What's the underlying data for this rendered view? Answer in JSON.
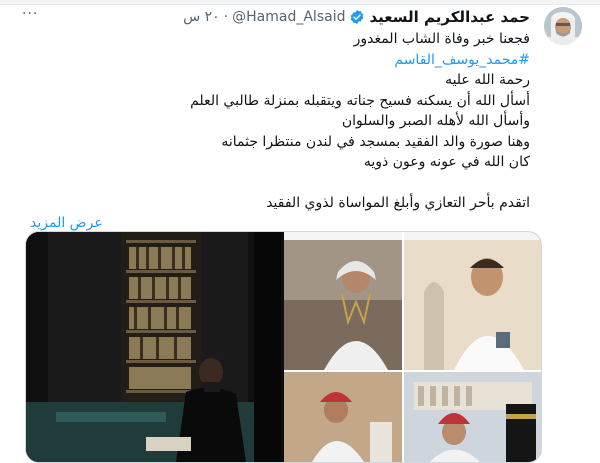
{
  "tweet": {
    "author_name": "حمد عبدالكريم السعيد",
    "handle": "@Hamad_Alsaid",
    "separator": "·",
    "timestamp": "٢٠ س",
    "more_label": "···",
    "lines": [
      "فجعنا خبر وفاة الشاب المغدور",
      "رحمة الله عليه",
      "أسأل الله أن يسكنه فسيح جناته ويتقبله بمنزلة طالبي العلم",
      "وأسأل الله لأهله الصبر والسلوان",
      "وهنا صورة والد الفقيد بمسجد في لندن منتظرا جثمانه",
      "كان الله في عونه وعون ذويه",
      "اتقدم بأحر التعازي وأبلغ  المواساة لذوي الفقيد"
    ],
    "hashtag": "#محمد_يوسف_القاسم",
    "show_more": "عرض المزيد"
  },
  "colors": {
    "link": "#1d9bf0",
    "text": "#0f1419",
    "secondary": "#536471",
    "verified": "#1d9bf0"
  }
}
